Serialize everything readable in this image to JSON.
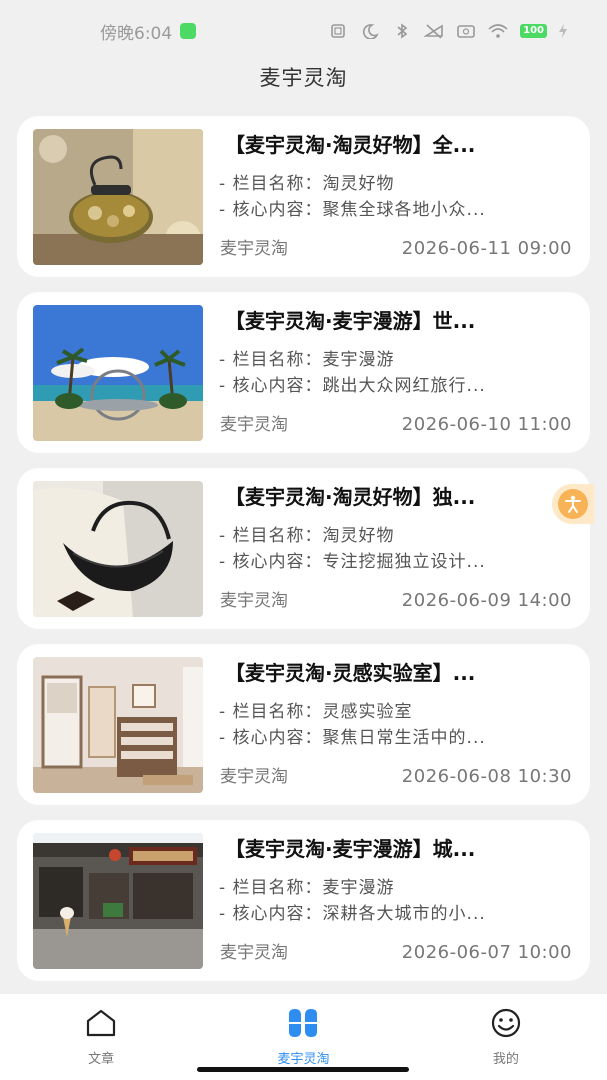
{
  "status_bar": {
    "time": "傍晚6:04",
    "battery": "100"
  },
  "header": {
    "title": "麦宇灵淘"
  },
  "articles": [
    {
      "title": "【麦宇灵淘·淘灵好物】全...",
      "column": "- 栏目名称：淘灵好物",
      "core": "- 核心内容：聚焦全球各地小众...",
      "author": "麦宇灵淘",
      "date": "2026-06-11 09:00"
    },
    {
      "title": "【麦宇灵淘·麦宇漫游】世...",
      "column": "- 栏目名称：麦宇漫游",
      "core": "- 核心内容：跳出大众网红旅行...",
      "author": "麦宇灵淘",
      "date": "2026-06-10 11:00"
    },
    {
      "title": "【麦宇灵淘·淘灵好物】独...",
      "column": "- 栏目名称：淘灵好物",
      "core": "- 核心内容：专注挖掘独立设计...",
      "author": "麦宇灵淘",
      "date": "2026-06-09 14:00"
    },
    {
      "title": "【麦宇灵淘·灵感实验室】...",
      "column": "- 栏目名称：灵感实验室",
      "core": "- 核心内容：聚焦日常生活中的...",
      "author": "麦宇灵淘",
      "date": "2026-06-08 10:30"
    },
    {
      "title": "【麦宇灵淘·麦宇漫游】城...",
      "column": "- 栏目名称：麦宇漫游",
      "core": "- 核心内容：深耕各大城市的小...",
      "author": "麦宇灵淘",
      "date": "2026-06-07 10:00"
    }
  ],
  "tabs": [
    {
      "label": "文章",
      "icon": "home-icon",
      "active": false
    },
    {
      "label": "麦宇灵淘",
      "icon": "four-leaf-grid-icon",
      "active": true
    },
    {
      "label": "我的",
      "icon": "smiley-face-icon",
      "active": false
    }
  ],
  "colors": {
    "accent": "#2e8ef0",
    "background": "#f0f0f0",
    "float_button": "#f7b356"
  }
}
